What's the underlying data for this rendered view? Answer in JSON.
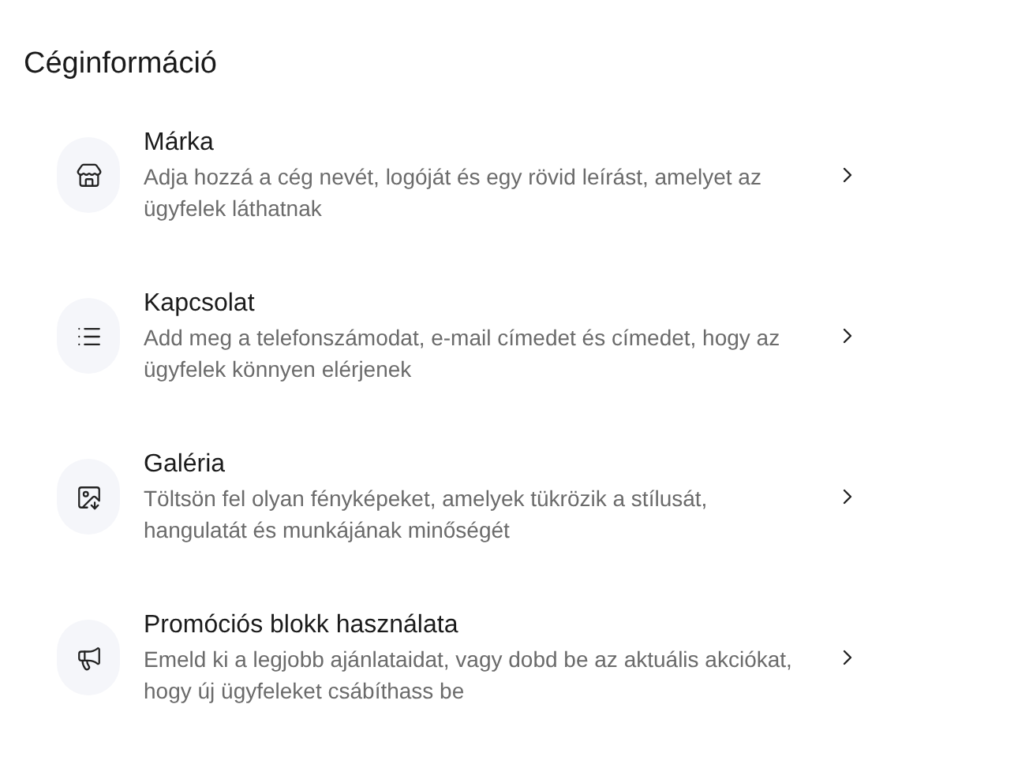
{
  "heading": "Céginformáció",
  "items": [
    {
      "title": "Márka",
      "description": "Adja hozzá a cég nevét, logóját és egy rövid leírást, amelyet az ügyfelek láthatnak"
    },
    {
      "title": "Kapcsolat",
      "description": "Add meg a telefonszámodat, e-mail címedet és címedet, hogy az ügyfelek könnyen elérjenek"
    },
    {
      "title": "Galéria",
      "description": "Töltsön fel olyan fényképeket, amelyek tükrözik a stílusát, hangulatát és munkájának minőségét"
    },
    {
      "title": "Promóciós blokk használata",
      "description": "Emeld ki a legjobb ajánlataidat, vagy dobd be az aktuális akciókat, hogy új ügyfeleket csábíthass be"
    }
  ]
}
